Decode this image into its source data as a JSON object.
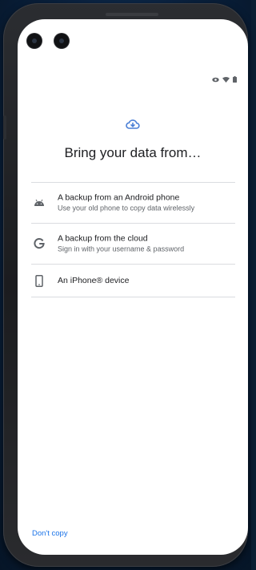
{
  "title": "Bring your data from…",
  "options": [
    {
      "icon": "android-icon",
      "primary": "A backup from an Android phone",
      "secondary": "Use your old phone to copy data wirelessly"
    },
    {
      "icon": "google-g-icon",
      "primary": "A backup from the cloud",
      "secondary": "Sign in with your username & password"
    },
    {
      "icon": "phone-device-icon",
      "primary": "An iPhone® device"
    }
  ],
  "footer": {
    "dont_copy": "Don't copy"
  },
  "status_icons": [
    "eye-icon",
    "wifi-icon",
    "battery-icon"
  ],
  "colors": {
    "accent": "#1a73e8",
    "text_primary": "#202124",
    "text_secondary": "#5f6368",
    "divider": "#dadce0",
    "cloud_icon": "#4a7fd6"
  }
}
